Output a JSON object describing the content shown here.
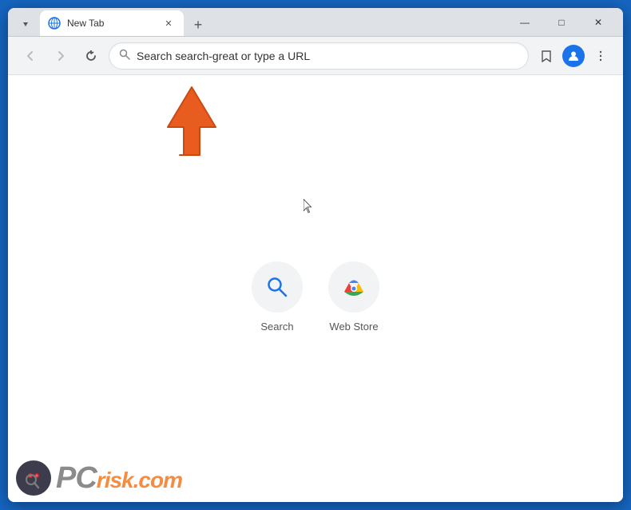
{
  "browser": {
    "tab": {
      "title": "New Tab",
      "favicon_label": "globe"
    },
    "window_controls": {
      "minimize": "—",
      "maximize": "□",
      "close": "✕"
    },
    "new_tab_button": "+",
    "address_bar": {
      "placeholder": "Search search-great or type a URL",
      "value": "Search search-great or type a URL"
    }
  },
  "nav": {
    "back_title": "Back",
    "forward_title": "Forward",
    "refresh_title": "Refresh"
  },
  "shortcuts": [
    {
      "id": "search",
      "label": "Search",
      "icon_type": "search"
    },
    {
      "id": "webstore",
      "label": "Web Store",
      "icon_type": "webstore"
    }
  ],
  "watermark": {
    "text_pc": "PC",
    "text_risk": "risk",
    "text_domain": ".com"
  },
  "colors": {
    "chrome_blue": "#1565c0",
    "tab_active_bg": "#ffffff",
    "nav_bg": "#f1f3f4",
    "shortcut_bg": "#f1f3f4",
    "arrow_color": "#e85c20"
  }
}
